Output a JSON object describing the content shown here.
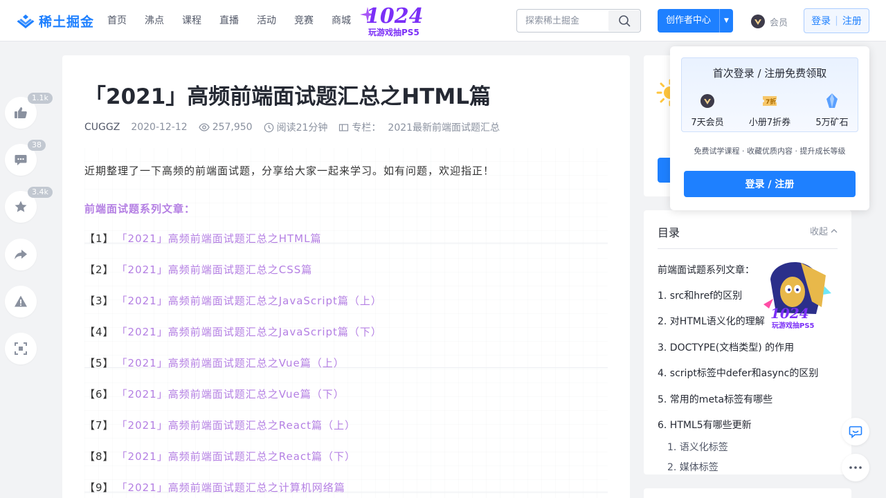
{
  "header": {
    "logo_text": "稀土掘金",
    "nav": [
      "首页",
      "沸点",
      "课程",
      "直播",
      "活动",
      "竞赛",
      "商城"
    ],
    "promo_big": "1024",
    "promo_small": "玩游戏抽PS5",
    "search_placeholder": "探索稀土掘金",
    "creator_label": "创作者中心",
    "vip_label": "会员",
    "login_label": "登录",
    "register_label": "注册"
  },
  "actions": {
    "like_count": "1.1k",
    "comment_count": "38",
    "star_count": "3.4k"
  },
  "article": {
    "title": "「2021」高频前端面试题汇总之HTML篇",
    "author": "CUGGZ",
    "date": "2020-12-12",
    "views": "257,950",
    "read_time": "阅读21分钟",
    "column_prefix": "专栏：",
    "column_name": "2021最新前端面试题汇总",
    "intro": "近期整理了一下高频的前端面试题，分享给大家一起来学习。如有问题，欢迎指正！",
    "series_heading": "前端面试题系列文章：",
    "series": [
      {
        "num": "【1】",
        "title": "「2021」高频前端面试题汇总之HTML篇"
      },
      {
        "num": "【2】",
        "title": "「2021」高频前端面试题汇总之CSS篇"
      },
      {
        "num": "【3】",
        "title": "「2021」高频前端面试题汇总之JavaScript篇（上）"
      },
      {
        "num": "【4】",
        "title": "「2021」高频前端面试题汇总之JavaScript篇（下）"
      },
      {
        "num": "【5】",
        "title": "「2021」高频前端面试题汇总之Vue篇（上）"
      },
      {
        "num": "【6】",
        "title": "「2021」高频前端面试题汇总之Vue篇（下）"
      },
      {
        "num": "【7】",
        "title": "「2021」高频前端面试题汇总之React篇（上）"
      },
      {
        "num": "【8】",
        "title": "「2021」高频前端面试题汇总之React篇（下）"
      },
      {
        "num": "【9】",
        "title": "「2021」高频前端面试题汇总之计算机网络篇"
      }
    ]
  },
  "toc": {
    "title": "目录",
    "collapse": "收起",
    "items": [
      "前端面试题系列文章：",
      "1. src和href的区别",
      "2. 对HTML语义化的理解",
      "3. DOCTYPE(文档类型) 的作用",
      "4. script标签中defer和async的区别",
      "5. 常用的meta标签有哪些",
      "6. HTML5有哪些更新"
    ],
    "sub_items": [
      "1. 语义化标签",
      "2. 媒体标签"
    ],
    "art_big": "1024",
    "art_small": "玩游戏抽PS5"
  },
  "popup": {
    "title": "首次登录 / 注册免费领取",
    "rewards": [
      "7天会员",
      "小册7折券",
      "5万矿石"
    ],
    "coupon_mark": "7折",
    "subtitle": "免费试学课程 · 收藏优质内容 · 提升成长等级",
    "button": "登录 / 注册"
  },
  "colors": {
    "brand": "#1e80ff",
    "link_purple": "#b47fe3",
    "text": "#252933"
  }
}
